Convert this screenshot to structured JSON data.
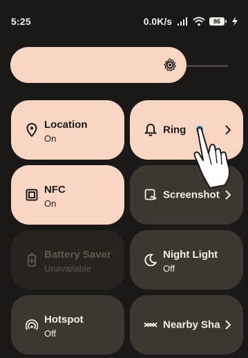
{
  "status": {
    "time": "5:25",
    "net_speed": "0.0K/s",
    "battery_level": "86",
    "icons": [
      "signal-icon",
      "wifi-icon",
      "battery-icon",
      "charging-icon"
    ]
  },
  "brightness": {
    "icon": "brightness-icon"
  },
  "tiles": {
    "location": {
      "label": "Location",
      "state": "On",
      "icon": "location-icon"
    },
    "ring": {
      "label": "Ring",
      "icon": "bell-icon",
      "chevron": "chevron-right-icon"
    },
    "nfc": {
      "label": "NFC",
      "state": "On",
      "icon": "nfc-icon"
    },
    "screenshot": {
      "label": "Screenshot",
      "icon": "screenshot-icon",
      "chevron": "chevron-right-icon"
    },
    "battery_saver": {
      "label": "Battery Saver",
      "state": "Unavailable",
      "icon": "battery-saver-icon"
    },
    "night_light": {
      "label": "Night Light",
      "state": "Off",
      "icon": "night-light-icon"
    },
    "hotspot": {
      "label": "Hotspot",
      "state": "Off",
      "icon": "hotspot-icon"
    },
    "nearby_share": {
      "label": "Nearby Sha",
      "icon": "nearby-share-icon",
      "chevron": "chevron-right-icon"
    }
  },
  "colors": {
    "background": "#1b1917",
    "tile_active": "#f8d6c3",
    "tile_inactive": "#3c3731",
    "tile_unavailable": "#27231f",
    "tap_indicator": "#1e8fa5"
  }
}
